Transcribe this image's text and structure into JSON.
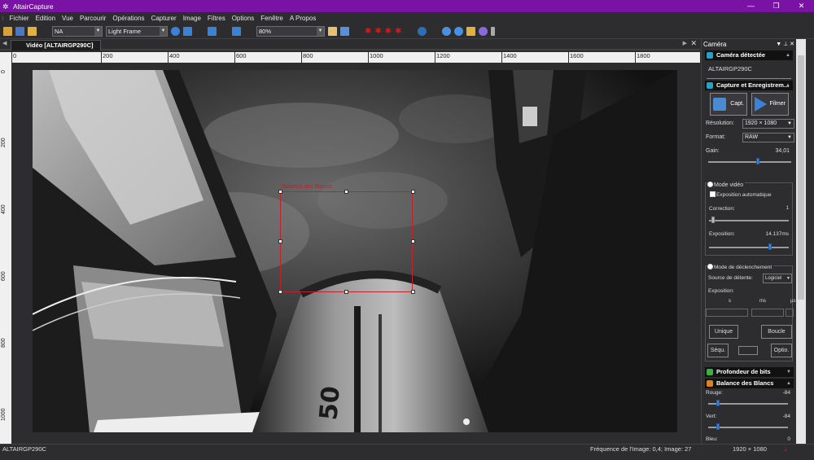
{
  "window": {
    "title": "AltairCapture",
    "minimize": "—",
    "maximize": "❐",
    "close": "✕"
  },
  "menu": [
    "Fichier",
    "Edition",
    "Vue",
    "Parcourir",
    "Opérations",
    "Capturer",
    "Image",
    "Filtres",
    "Options",
    "Fenêtre",
    "A Propos"
  ],
  "toolbar": {
    "select_na": "NA",
    "select_frame": "Light Frame",
    "zoom": "80%"
  },
  "document": {
    "tab_label": "Vidéo [ALTAIRGP290C]"
  },
  "ruler": {
    "h_labels": [
      "0",
      "200",
      "400",
      "600",
      "800",
      "1000",
      "1200",
      "1400",
      "1600",
      "1800"
    ],
    "v_labels": [
      "0",
      "200",
      "400",
      "600",
      "800",
      "1000"
    ]
  },
  "overlay": {
    "wb_label": "Balance des Blancs"
  },
  "panel": {
    "title": "Caméra",
    "sec_camera": "Caméra détectée",
    "camera_name": "ALTAIRGP290C",
    "sec_capture": "Capture et Enregistrem...",
    "btn_capture": "Capt.",
    "btn_film": "Filmer",
    "resolution_label": "Résolution:",
    "resolution_value": "1920 × 1080",
    "format_label": "Format:",
    "format_value": "RAW",
    "gain_label": "Gain:",
    "gain_value": "34,01",
    "gain_level": 0.6,
    "video_mode": "Mode vidéo",
    "auto_exposure": "Exposition automatique",
    "correction_label": "Correction:",
    "correction_value": "1",
    "correction_level": 0.05,
    "exposure_label": "Exposition:",
    "exposure_value": "14.137ms",
    "exposure_level": 0.77,
    "trigger_mode": "Mode de déclenchement",
    "trigger_source_label": "Source de détente:",
    "trigger_source_value": "Logiciel",
    "trigger_exposure_label": "Exposition:",
    "unit_s": "s",
    "unit_ms": "ms",
    "unit_us": "µs",
    "btn_single": "Unique",
    "btn_loop": "Boucle",
    "btn_seq": "Séqu.",
    "btn_opts": "Optio.",
    "sec_bitdepth": "Profondeur de bits",
    "sec_wb": "Balance des Blancs",
    "red_label": "Rouge:",
    "red_value": "-84",
    "red_level": 0.12,
    "green_label": "Vert:",
    "green_value": "-84",
    "green_level": 0.12,
    "blue_label": "Bleu:",
    "blue_value": "0"
  },
  "status": {
    "camera": "ALTAIRGP290C",
    "frequency": "Fréquence de l'Image: 0,4; Image: 27",
    "size": "1920 × 1080"
  }
}
